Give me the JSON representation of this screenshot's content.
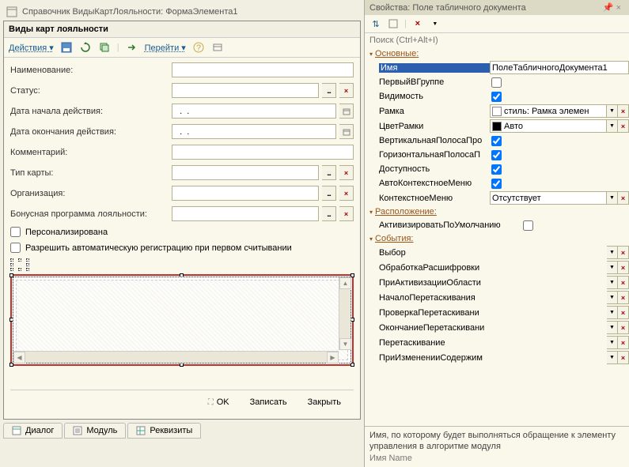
{
  "window": {
    "title": "Справочник ВидыКартЛояльности: ФормаЭлемента1"
  },
  "form": {
    "header": "Виды карт лояльности",
    "toolbar": {
      "actions": "Действия",
      "goto": "Перейти"
    },
    "fields": {
      "name_label": "Наименование:",
      "status_label": "Статус:",
      "date_start_label": "Дата начала действия:",
      "date_start_value": "  .  .    ",
      "date_end_label": "Дата окончания действия:",
      "date_end_value": "  .  .    ",
      "comment_label": "Комментарий:",
      "card_type_label": "Тип карты:",
      "org_label": "Организация:",
      "bonus_label": "Бонусная программа лояльности:",
      "personalized_label": "Персонализирована",
      "auto_reg_label": "Разрешить автоматическую регистрацию при первом считывании"
    },
    "footer": {
      "ok": "OK",
      "save": "Записать",
      "close": "Закрыть"
    }
  },
  "tabs": {
    "dialog": "Диалог",
    "module": "Модуль",
    "requisites": "Реквизиты"
  },
  "props": {
    "title": "Свойства: Поле табличного документа",
    "search_placeholder": "Поиск (Ctrl+Alt+I)",
    "sections": {
      "main": "Основные:",
      "layout": "Расположение:",
      "events": "События:"
    },
    "main": {
      "name_label": "Имя",
      "name_value": "ПолеТабличногоДокумента1",
      "first_in_group": "ПервыйВГруппе",
      "visibility": "Видимость",
      "frame": "Рамка",
      "frame_value": "стиль: Рамка элемен",
      "frame_color": "ЦветРамки",
      "frame_color_value": "Авто",
      "vscroll": "ВертикальнаяПолосаПро",
      "hscroll": "ГоризонтальнаяПолосаП",
      "availability": "Доступность",
      "auto_context": "АвтоКонтекстноеМеню",
      "context_menu": "КонтекстноеМеню",
      "context_menu_value": "Отсутствует"
    },
    "layout": {
      "activate_default": "АктивизироватьПоУмолчанию"
    },
    "events": {
      "selection": "Выбор",
      "process_detail": "ОбработкаРасшифровки",
      "on_activate_area": "ПриАктивизацииОбласти",
      "drag_start": "НачалоПеретаскивания",
      "drag_check": "ПроверкаПеретаскивани",
      "drag_end": "ОкончаниеПеретаскивани",
      "drag": "Перетаскивание",
      "content_change": "ПриИзмененииСодержим"
    },
    "description": "Имя, по которому будет выполняться обращение к элементу управления в алгоритме модуля",
    "description_en": "Имя  Name"
  }
}
